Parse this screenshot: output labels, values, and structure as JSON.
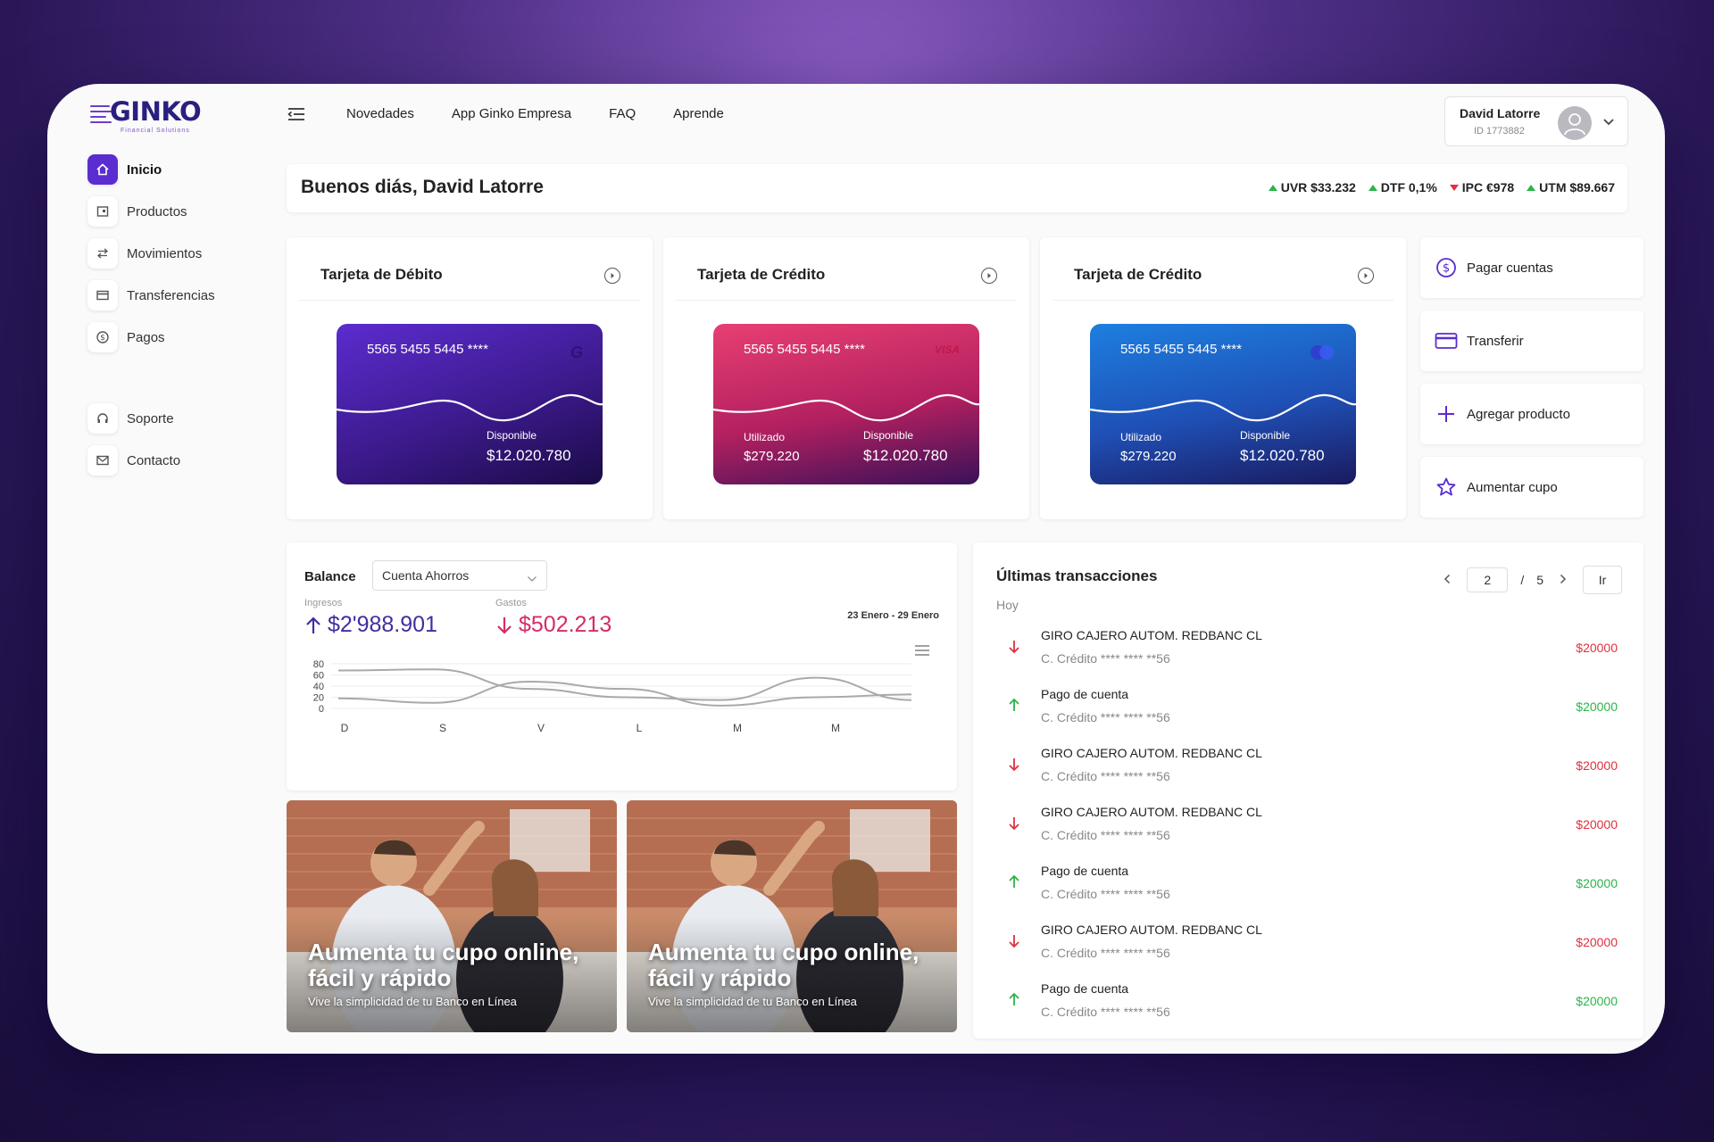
{
  "brand": {
    "logo": "GINKO",
    "tagline": "Financial Solutions"
  },
  "colors": {
    "accent": "#5b2ccf",
    "up": "#2cb44a",
    "down": "#e0303e",
    "income": "#3f2fa0",
    "expense": "#d62a6a"
  },
  "sidebar": {
    "items": [
      {
        "label": "Inicio",
        "icon": "home-icon"
      },
      {
        "label": "Productos",
        "icon": "products-icon"
      },
      {
        "label": "Movimientos",
        "icon": "arrows-swap-icon"
      },
      {
        "label": "Transferencias",
        "icon": "card-icon"
      },
      {
        "label": "Pagos",
        "icon": "coin-icon"
      }
    ],
    "secondary": [
      {
        "label": "Soporte",
        "icon": "headset-icon"
      },
      {
        "label": "Contacto",
        "icon": "mail-icon"
      }
    ]
  },
  "topnav": {
    "links": [
      "Novedades",
      "App Ginko Empresa",
      "FAQ",
      "Aprende"
    ]
  },
  "user": {
    "name": "David Latorre",
    "id": "ID 1773882"
  },
  "greeting": "Buenos diás, David Latorre",
  "indicators": [
    {
      "label": "UVR $33.232",
      "trend": "up"
    },
    {
      "label": "DTF 0,1%",
      "trend": "up"
    },
    {
      "label": "IPC €978",
      "trend": "down"
    },
    {
      "label": "UTM $89.667",
      "trend": "up"
    }
  ],
  "cards": [
    {
      "title": "Tarjeta de Débito",
      "number": "5565 5455 5445 ****",
      "brand": "G",
      "used_label": "",
      "used": "",
      "available_label": "Disponible",
      "available": "$12.020.780"
    },
    {
      "title": "Tarjeta de Crédito",
      "number": "5565 5455 5445 ****",
      "brand": "VISA",
      "used_label": "Utilizado",
      "used": "$279.220",
      "available_label": "Disponible",
      "available": "$12.020.780"
    },
    {
      "title": "Tarjeta de Crédito",
      "number": "5565 5455 5445 ****",
      "brand": "mastercard-icon",
      "used_label": "Utilizado",
      "used": "$279.220",
      "available_label": "Disponible",
      "available": "$12.020.780"
    }
  ],
  "quick_actions": [
    {
      "label": "Pagar cuentas",
      "icon": "dollar-circle-icon"
    },
    {
      "label": "Transferir",
      "icon": "card-icon"
    },
    {
      "label": "Agregar producto",
      "icon": "plus-icon"
    },
    {
      "label": "Aumentar cupo",
      "icon": "star-icon"
    }
  ],
  "balance": {
    "title": "Balance",
    "account": "Cuenta Ahorros",
    "income_label": "Ingresos",
    "income": "$2'988.901",
    "expense_label": "Gastos",
    "expense": "$502.213",
    "range": "23 Enero - 29 Enero"
  },
  "chart_data": {
    "type": "line",
    "categories": [
      "D",
      "S",
      "V",
      "L",
      "M",
      "M"
    ],
    "yticks": [
      80,
      60,
      40,
      20,
      0
    ],
    "ylim": [
      0,
      80
    ],
    "grid": true,
    "series": [
      {
        "values": [
          68,
          70,
          35,
          20,
          15,
          55,
          15
        ],
        "color": "#a9a9a9"
      },
      {
        "values": [
          18,
          10,
          48,
          35,
          5,
          20,
          25
        ],
        "color": "#a9a9a9"
      }
    ]
  },
  "promos": [
    {
      "title": "Aumenta tu cupo online, fácil y rápido",
      "subtitle": "Vive la simplicidad de tu Banco en Línea"
    },
    {
      "title": "Aumenta tu cupo online, fácil y rápido",
      "subtitle": "Vive la simplicidad de tu Banco en Línea"
    }
  ],
  "transactions": {
    "title": "Últimas transacciones",
    "day": "Hoy",
    "page": "2",
    "pages": "5",
    "separator": "/",
    "go": "Ir",
    "items": [
      {
        "name": "GIRO CAJERO AUTOM. REDBANC CL",
        "card": "C. Crédito **** **** **56",
        "amount": "$20000",
        "type": "out"
      },
      {
        "name": "Pago de cuenta",
        "card": "C. Crédito **** **** **56",
        "amount": "$20000",
        "type": "in"
      },
      {
        "name": "GIRO CAJERO AUTOM. REDBANC CL",
        "card": "C. Crédito **** **** **56",
        "amount": "$20000",
        "type": "out"
      },
      {
        "name": "GIRO CAJERO AUTOM. REDBANC CL",
        "card": "C. Crédito **** **** **56",
        "amount": "$20000",
        "type": "out"
      },
      {
        "name": "Pago de cuenta",
        "card": "C. Crédito **** **** **56",
        "amount": "$20000",
        "type": "in"
      },
      {
        "name": "GIRO CAJERO AUTOM. REDBANC CL",
        "card": "C. Crédito **** **** **56",
        "amount": "$20000",
        "type": "out"
      },
      {
        "name": "Pago de cuenta",
        "card": "C. Crédito **** **** **56",
        "amount": "$20000",
        "type": "in"
      }
    ]
  }
}
